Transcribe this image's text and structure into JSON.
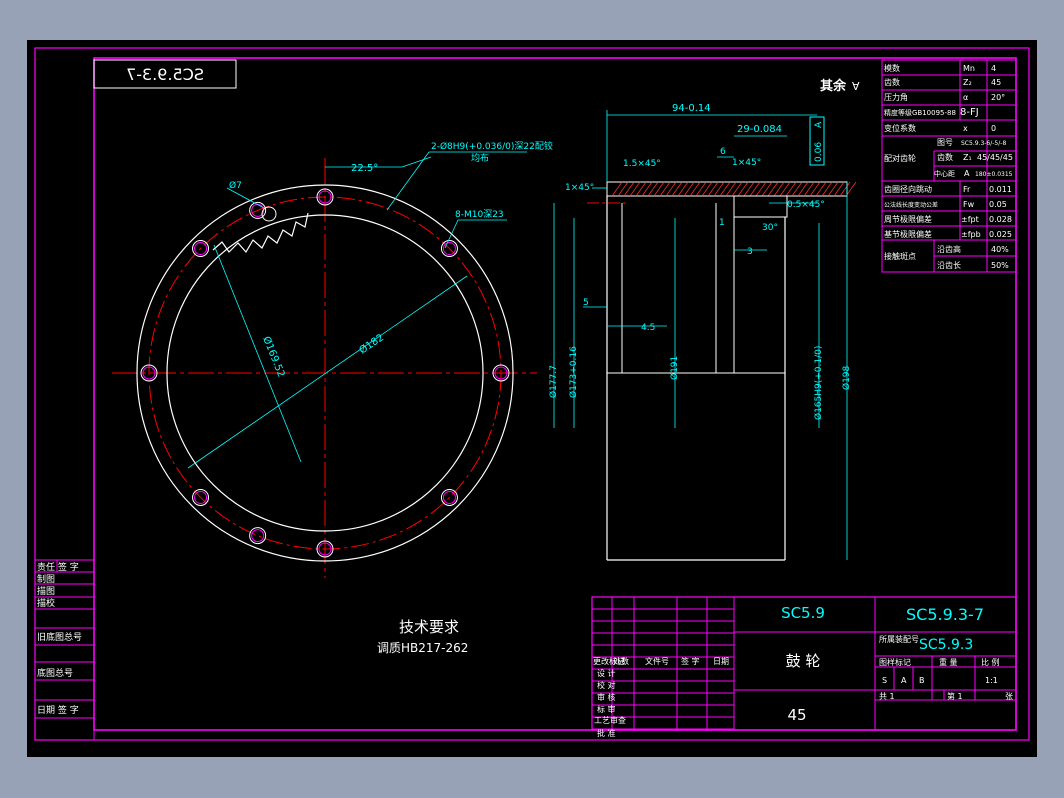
{
  "colors": {
    "background": "#98a2b6",
    "paper": "#000000",
    "frame": "#ff00ff",
    "outline": "#ffffff",
    "dimension": "#00ffff",
    "centerline": "#ff0000",
    "hatch": "#ff3333",
    "hole_highlight": "#ff00ff"
  },
  "drawing": {
    "code_box_mirrored": "SC5.9.3-7",
    "surface_note": "其余",
    "front_view": {
      "angle": "22.5°",
      "hole_note_1": "2-Ø8H9(+0.036/0)深22配铰",
      "hole_note_1_sub": "均布",
      "hole_note_2": "8-M10深23",
      "dia_small": "Ø7",
      "dia_pcd": "Ø182",
      "dia_inner": "Ø169.52"
    },
    "section_view": {
      "len_total": "94-0.14",
      "len_flange": "29-0.084",
      "tol_box": "0.06",
      "datum": "A",
      "chamfer_1": "1.5×45°",
      "chamfer_2": "1×45°",
      "chamfer_3": "1×45°",
      "chamfer_4": "0.5×45°",
      "dim_6": "6",
      "dim_1": "1",
      "dim_3": "3",
      "dim_5": "5",
      "dim_4_5": "4.5",
      "angle_30": "30°",
      "dia_177": "Ø177.7",
      "dia_173": "Ø173+0.16",
      "dia_191": "Ø191",
      "dia_165": "Ø165H9(+0.1/0)",
      "dia_198": "Ø198"
    },
    "tech_req": {
      "title": "技术要求",
      "line1": "调质HB217-262"
    }
  },
  "param_table": {
    "rows": [
      {
        "label": "模数",
        "sym": "Mn",
        "val": "4"
      },
      {
        "label": "齿数",
        "sym": "Z₂",
        "val": "45"
      },
      {
        "label": "压力角",
        "sym": "α",
        "val": "20°"
      },
      {
        "label": "精度等级GB10095-88",
        "sym": "",
        "val": "8-FJ"
      },
      {
        "label": "变位系数",
        "sym": "x",
        "val": "0"
      }
    ],
    "mating_label": "配对齿轮",
    "mating_rows": [
      {
        "label": "图号",
        "val": "SC5.9.3-6/-5/-8"
      },
      {
        "label": "齿数",
        "sym": "Z₁",
        "val": "45/45/45"
      },
      {
        "label": "中心距",
        "sym": "A",
        "val": "180±0.0315"
      }
    ],
    "rows2": [
      {
        "label": "齿圈径向跳动",
        "sym": "Fr",
        "val": "0.011"
      },
      {
        "label": "公法线长度变动公差",
        "sym": "Fw",
        "val": "0.05"
      },
      {
        "label": "周节极限偏差",
        "sym": "±fpt",
        "val": "0.028"
      },
      {
        "label": "基节极限偏差",
        "sym": "±fpb",
        "val": "0.025"
      }
    ],
    "contact_label": "接触斑点",
    "contact_rows": [
      {
        "label": "沿齿高",
        "val": "40%"
      },
      {
        "label": "沿齿长",
        "val": "50%"
      }
    ]
  },
  "left_strip": {
    "rows": [
      "责任 签 字",
      "制图",
      "描图",
      "描校"
    ],
    "old_drawing": "旧底图总号",
    "base_drawing": "底图总号",
    "date_sign": "日期 签 字"
  },
  "title_block": {
    "project": "SC5.9",
    "drawing_no": "SC5.9.3-7",
    "assembly_label": "所属装配号",
    "assembly_no": "SC5.9.3",
    "part_name": "鼓 轮",
    "material": "45",
    "rev_headers": [
      "更改标记",
      "处数",
      "文件号",
      "签 字",
      "日期"
    ],
    "sign_rows": [
      "设 计",
      "校 对",
      "审 核",
      "标 审",
      "工艺审查",
      "批 准"
    ],
    "stage_label": "图样标记",
    "stage_values": [
      "S",
      "A",
      "B"
    ],
    "weight_label": "重 量",
    "scale_label": "比 例",
    "scale_value": "1:1",
    "sheets_total": "共 1",
    "sheet_no": "第 1",
    "sheet_unit": "张"
  }
}
